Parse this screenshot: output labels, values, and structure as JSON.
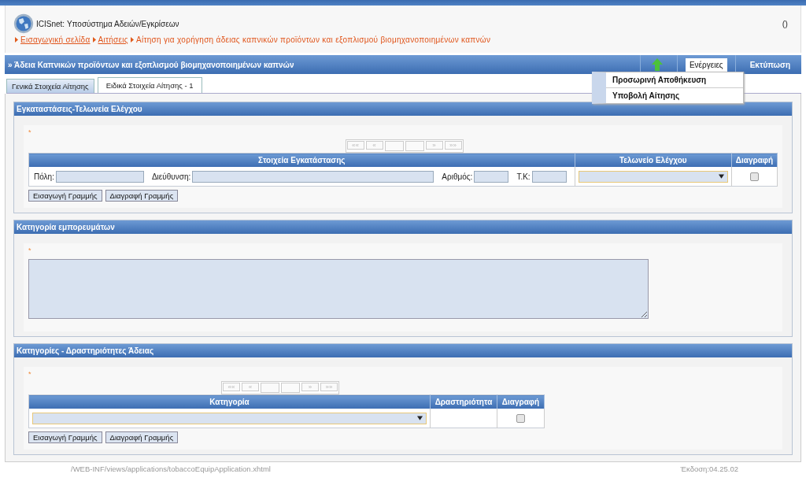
{
  "header": {
    "app_title": "ICISnet: Υποσύστημα Αδειών/Εγκρίσεων",
    "counter": "()"
  },
  "breadcrumb": [
    {
      "text": "Εισαγωγική σελίδα",
      "link": true
    },
    {
      "text": "Αιτήσεις",
      "link": true
    },
    {
      "text": "Αίτηση για χορήγηση άδειας καπνικών προϊόντων και εξοπλισμού βιομηχανοποιημένων καπνών",
      "link": false
    }
  ],
  "page_title": "» Άδεια Καπνικών προϊόντων και εξοπλισμού βιομηχανοποιημένων καπνών",
  "toolbar": {
    "actions": "Ενέργειες",
    "print": "Εκτύπωση"
  },
  "actions_menu": [
    "Προσωρινή Αποθήκευση",
    "Υποβολή Αίτησης"
  ],
  "tabs": [
    {
      "label": "Γενικά Στοιχεία Αίτησης",
      "selected": false
    },
    {
      "label": "Ειδικά Στοιχεία Αίτησης - 1",
      "selected": true
    }
  ],
  "sections": [
    {
      "kind": "table",
      "title": "Εγκαταστάσεις-Τελωνεία Ελέγχου",
      "required_mark": "*",
      "pager": [
        "««",
        "«",
        "»",
        "»»"
      ],
      "columns": [
        "Στοιχεία Εγκατάστασης",
        "Τελωνείο Ελέγχου",
        "Διαγραφή"
      ],
      "row": [
        {
          "kind": "fields",
          "fields": [
            {
              "label": "Πόλη:"
            },
            {
              "label": "Διεύθυνση:"
            },
            {
              "label": "Αριθμός:"
            },
            {
              "label": "Τ.Κ:"
            }
          ]
        },
        {
          "kind": "select"
        },
        {
          "kind": "checkbox",
          "checked": false
        }
      ],
      "buttons": [
        "Εισαγωγή Γραμμής",
        "Διαγραφή Γραμμής"
      ]
    },
    {
      "kind": "textarea",
      "title": "Κατηγορία εμπορευμάτων",
      "required_mark": "*"
    },
    {
      "kind": "table",
      "title": "Κατηγορίες - Δραστηριότητες Άδειας",
      "required_mark": "*",
      "pager": [
        "««",
        "«",
        "»",
        "»»"
      ],
      "columns": [
        "Κατηγορία",
        "Δραστηριότητα",
        "Διαγραφή"
      ],
      "row": [
        {
          "kind": "select"
        },
        {
          "kind": "empty"
        },
        {
          "kind": "checkbox",
          "checked": false
        }
      ],
      "buttons": [
        "Εισαγωγή Γραμμής",
        "Διαγραφή Γραμμής"
      ]
    }
  ],
  "footer": {
    "path": "/WEB-INF/views/applications/tobaccoEquipApplication.xhtml",
    "version": "Έκδοση:04.25.02"
  }
}
